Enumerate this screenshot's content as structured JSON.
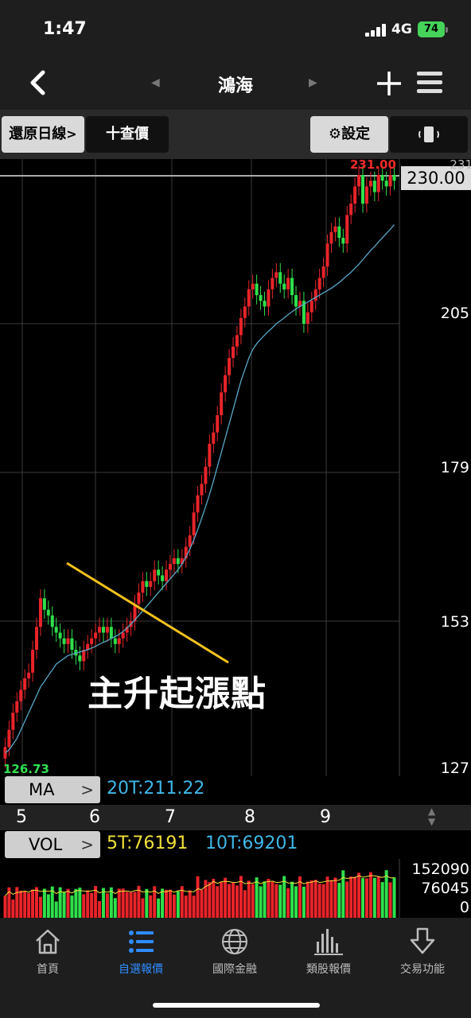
{
  "status": {
    "time": "1:47",
    "network": "4G",
    "battery": "74"
  },
  "nav": {
    "title": "鴻海",
    "back_icon": "chevron-left-icon",
    "add_icon": "plus-icon",
    "menu_icon": "hamburger-icon"
  },
  "toolbar": {
    "restore_label": "還原日線",
    "query_label": "十查價",
    "settings_label": "設定",
    "rotate_icon": "rotate-phone-icon"
  },
  "chart": {
    "high_label": "231.00",
    "last_price": "230.00",
    "low_label": "126.73",
    "annotation": "主升起漲點",
    "y_ticks": [
      {
        "label": "231",
        "value": 231
      },
      {
        "label": "205",
        "value": 205
      },
      {
        "label": "179",
        "value": 179
      },
      {
        "label": "153",
        "value": 153
      },
      {
        "label": "127",
        "value": 127
      }
    ],
    "colors": {
      "up": "#e8242a",
      "down": "#2fe04b",
      "ma": "#58a7c8",
      "trendline": "#f2c21c",
      "grid": "#3a3a3a"
    }
  },
  "ma": {
    "button_label": "MA",
    "value_text": "20T:211.22"
  },
  "dates": [
    "5",
    "6",
    "7",
    "8",
    "9"
  ],
  "vol": {
    "button_label": "VOL",
    "v5_text": "5T:76191",
    "v10_text": "10T:69201",
    "ticks": [
      "152090",
      "76045",
      "0"
    ]
  },
  "tabs": [
    {
      "label": "首頁",
      "icon": "home-icon",
      "active": false
    },
    {
      "label": "自選報價",
      "icon": "list-icon",
      "active": true
    },
    {
      "label": "國際金融",
      "icon": "globe-icon",
      "active": false
    },
    {
      "label": "類股報價",
      "icon": "bar-chart-icon",
      "active": false
    },
    {
      "label": "交易功能",
      "icon": "download-arrow-icon",
      "active": false
    }
  ],
  "chart_data": {
    "type": "candlestick",
    "ylim": [
      126.73,
      231
    ],
    "x": [
      1,
      2,
      3,
      4,
      5,
      6,
      7,
      8,
      9,
      10,
      11,
      12,
      13,
      14,
      15,
      16,
      17,
      18,
      19,
      20,
      21,
      22,
      23,
      24,
      25,
      26,
      27,
      28,
      29,
      30,
      31,
      32,
      33,
      34,
      35,
      36,
      37,
      38,
      39,
      40,
      41,
      42,
      43,
      44,
      45,
      46,
      47,
      48,
      49,
      50,
      51,
      52,
      53,
      54,
      55,
      56,
      57,
      58,
      59,
      60,
      61,
      62,
      63,
      64,
      65,
      66,
      67,
      68,
      69,
      70,
      71,
      72,
      73,
      74,
      75,
      76,
      77,
      78,
      79,
      80,
      81,
      82,
      83,
      84,
      85,
      86,
      87,
      88,
      89,
      90,
      91,
      92,
      93,
      94,
      95,
      96,
      97,
      98,
      99,
      100
    ],
    "close": [
      131,
      134,
      137,
      139,
      141,
      143,
      144,
      148,
      152,
      157,
      155,
      154,
      152,
      151,
      150,
      149,
      150,
      148,
      147,
      146,
      148,
      149,
      150,
      151,
      152,
      151,
      152,
      150,
      149,
      150,
      151,
      152,
      153,
      156,
      158,
      160,
      159,
      160,
      162,
      161,
      160,
      162,
      163,
      164,
      163,
      164,
      166,
      168,
      172,
      175,
      177,
      180,
      184,
      186,
      189,
      193,
      196,
      199,
      201,
      203,
      206,
      208,
      211,
      212,
      210,
      209,
      208,
      211,
      213,
      214,
      212,
      211,
      213,
      210,
      208,
      209,
      205,
      207,
      209,
      211,
      213,
      215,
      219,
      221,
      222,
      220,
      219,
      224,
      226,
      229,
      231,
      226,
      229,
      230,
      228,
      231,
      230,
      229,
      231,
      230
    ],
    "ma20": [
      130,
      130.5,
      131.5,
      132.5,
      134,
      135.5,
      137,
      138.5,
      140,
      141.5,
      142.5,
      143.5,
      144.5,
      145.5,
      146,
      146.5,
      147,
      147.2,
      147.4,
      147.6,
      147.8,
      148,
      148.3,
      148.6,
      149,
      149.3,
      149.6,
      150,
      150.3,
      150.7,
      151.2,
      151.8,
      152.5,
      153.2,
      154,
      154.8,
      155.6,
      156.4,
      157.2,
      158,
      158.8,
      159.6,
      160.4,
      161.2,
      162,
      163,
      164.2,
      165.6,
      167.2,
      169,
      171,
      173,
      175.2,
      177.5,
      180,
      182.5,
      185,
      187.5,
      190,
      192.5,
      195,
      197,
      199,
      200.5,
      201.5,
      202.3,
      203,
      203.7,
      204.3,
      205,
      205.5,
      206,
      206.6,
      207.1,
      207.6,
      208,
      208.4,
      208.8,
      209.2,
      209.6,
      210,
      210.4,
      210.8,
      211.2,
      211.7,
      212.2,
      212.8,
      213.4,
      214,
      214.7,
      215.4,
      216.2,
      217,
      217.8,
      218.5,
      219.3,
      220,
      220.8,
      221.5,
      222.3
    ]
  }
}
